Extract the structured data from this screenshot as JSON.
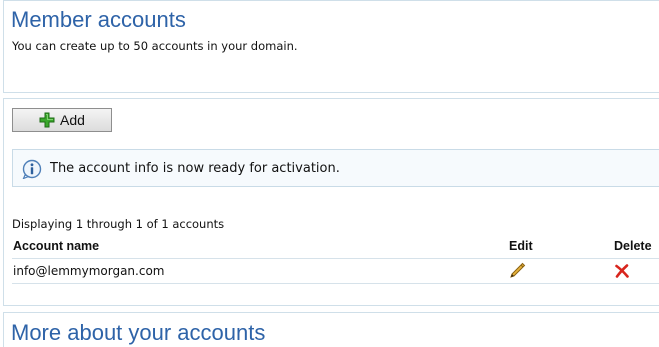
{
  "header": {
    "title": "Member accounts",
    "subtitle": "You can create up to 50 accounts in your domain."
  },
  "toolbar": {
    "add_label": "Add"
  },
  "notice": {
    "message": "The account info is now ready for activation.",
    "icon": "info-icon"
  },
  "accounts": {
    "summary": "Displaying 1 through 1 of 1 accounts",
    "columns": {
      "name": "Account name",
      "edit": "Edit",
      "delete": "Delete"
    },
    "rows": [
      {
        "name": "info@lemmymorgan.com",
        "edit_icon": "pencil-icon",
        "delete_icon": "red-x-icon"
      }
    ]
  },
  "more": {
    "title": "More about your accounts"
  },
  "colors": {
    "heading": "#2e63a8",
    "panel_border": "#cfdfe9",
    "add_green": "#3aa82c",
    "delete_red": "#d8251d"
  }
}
